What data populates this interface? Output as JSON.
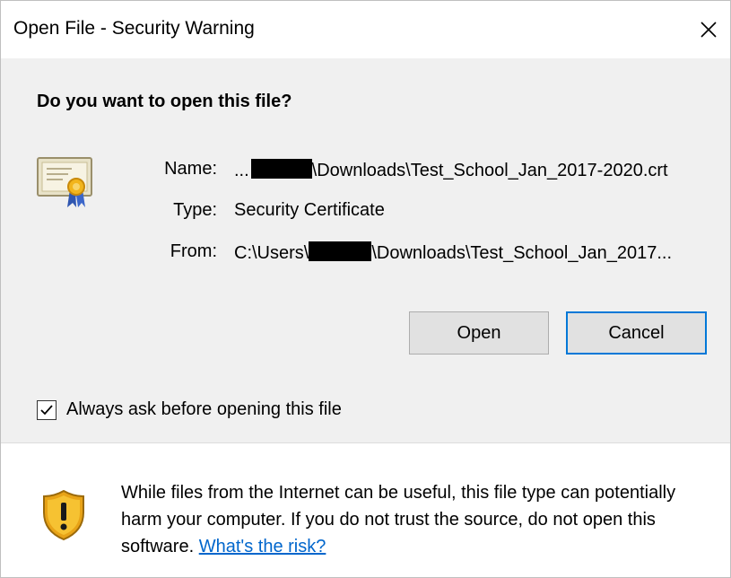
{
  "window": {
    "title": "Open File - Security Warning"
  },
  "question": "Do you want to open this file?",
  "file_info": {
    "name_label": "Name:",
    "name_prefix": "...",
    "name_suffix": "\\Downloads\\Test_School_Jan_2017-2020.crt",
    "type_label": "Type:",
    "type_value": "Security Certificate",
    "from_label": "From:",
    "from_prefix": "C:\\Users\\",
    "from_suffix": "\\Downloads\\Test_School_Jan_2017..."
  },
  "buttons": {
    "open": "Open",
    "cancel": "Cancel"
  },
  "checkbox": {
    "label": "Always ask before opening this file",
    "checked": true
  },
  "warning": {
    "text": "While files from the Internet can be useful, this file type can potentially harm your computer. If you do not trust the source, do not open this software.",
    "link": "What's the risk?"
  },
  "icons": {
    "certificate": "certificate-icon",
    "shield": "warning-shield-icon",
    "close": "close-icon",
    "check": "checkmark-icon"
  },
  "colors": {
    "accent": "#0078d7",
    "link": "#0066cc"
  }
}
